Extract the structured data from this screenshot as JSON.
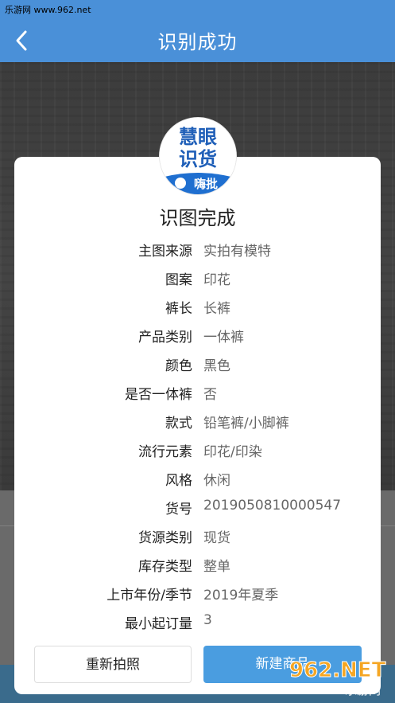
{
  "status_bar": {
    "text": "乐游网 www.962.net"
  },
  "header": {
    "title": "识别成功",
    "back_icon": "chevron-left-icon"
  },
  "card": {
    "logo_text": {
      "line1": "慧眼",
      "line2": "识货",
      "line3": "嗨批"
    },
    "title": "识图完成",
    "rows": [
      {
        "label": "主图来源",
        "value": "实拍有模特"
      },
      {
        "label": "图案",
        "value": "印花"
      },
      {
        "label": "裤长",
        "value": "长裤"
      },
      {
        "label": "产品类别",
        "value": "一体裤"
      },
      {
        "label": "颜色",
        "value": "黑色"
      },
      {
        "label": "是否一体裤",
        "value": "否"
      },
      {
        "label": "款式",
        "value": "铅笔裤/小脚裤"
      },
      {
        "label": "流行元素",
        "value": "印花/印染"
      },
      {
        "label": "风格",
        "value": "休闲"
      },
      {
        "label": "货号",
        "value": "2019050810000547"
      },
      {
        "label": "货源类别",
        "value": "现货"
      },
      {
        "label": "库存类型",
        "value": "整单"
      },
      {
        "label": "上市年份/季节",
        "value": "2019年夏季"
      },
      {
        "label": "最小起订量",
        "value": "3"
      }
    ],
    "retake_label": "重新拍照",
    "new_label": "新建商品"
  },
  "watermark": {
    "text": "962.NET",
    "sub": "乐游网"
  },
  "colors": {
    "header": "#4a90d8",
    "primary_button": "#4a9de0",
    "logo_blue": "#1f5fb8"
  }
}
